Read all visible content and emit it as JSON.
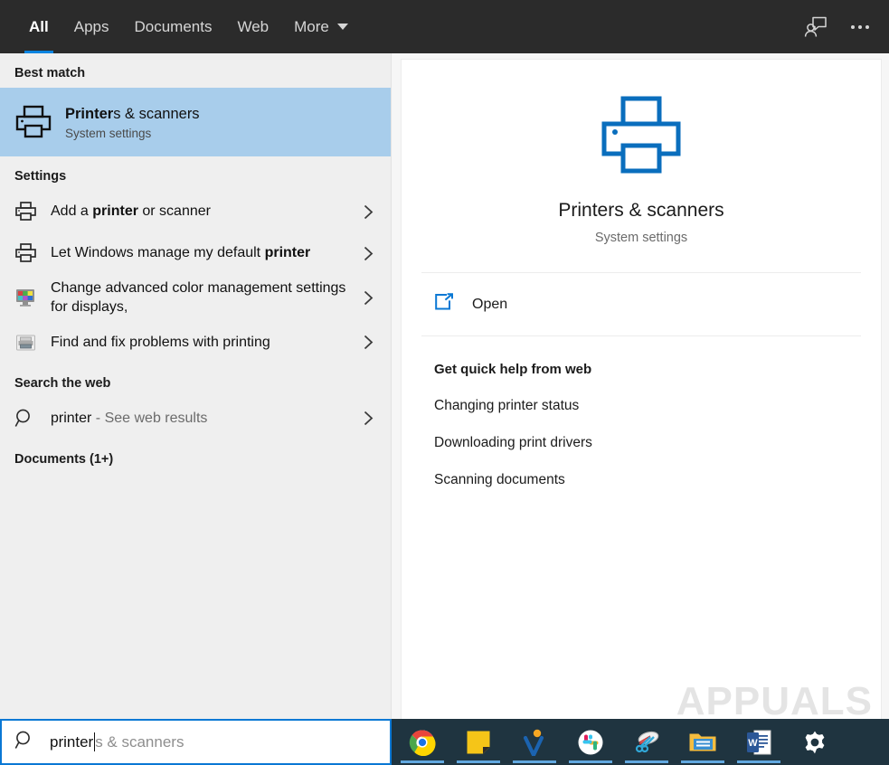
{
  "header": {
    "tabs": [
      {
        "label": "All",
        "active": true
      },
      {
        "label": "Apps",
        "active": false
      },
      {
        "label": "Documents",
        "active": false
      },
      {
        "label": "Web",
        "active": false
      },
      {
        "label": "More",
        "active": false,
        "has_caret": true
      }
    ],
    "feedback_icon": "feedback-person-icon",
    "overflow_icon": "more-options-icon",
    "accent_color": "#0a84e0",
    "background_color": "#2b2b2b"
  },
  "left_pane": {
    "best_match": {
      "section_label": "Best match",
      "title_bold": "Printer",
      "title_rest": "s & scanners",
      "subtitle": "System settings",
      "icon": "printer-icon",
      "highlight_color": "#a8cdeb"
    },
    "settings": {
      "section_label": "Settings",
      "items": [
        {
          "pre": "Add a ",
          "bold": "printer",
          "post": " or scanner",
          "icon": "printer-small-icon"
        },
        {
          "pre": "Let Windows manage my default ",
          "bold": "printer",
          "post": "",
          "icon": "printer-small-icon"
        },
        {
          "pre": "Change advanced color management settings for displays,",
          "bold": "",
          "post": "",
          "icon": "color-monitor-icon"
        },
        {
          "pre": "Find and fix problems with printing",
          "bold": "",
          "post": "",
          "icon": "printer-legacy-icon"
        }
      ]
    },
    "web": {
      "section_label": "Search the web",
      "query": "printer",
      "suffix": " - See web results",
      "icon": "search-icon"
    },
    "documents": {
      "section_label": "Documents (1+)"
    }
  },
  "right_pane": {
    "hero": {
      "icon": "printer-large-icon",
      "icon_color": "#0a6ebd",
      "title": "Printers & scanners",
      "subtitle": "System settings"
    },
    "open_action": {
      "label": "Open",
      "icon": "open-external-icon"
    },
    "help": {
      "title": "Get quick help from web",
      "links": [
        "Changing printer status",
        "Downloading print drivers",
        "Scanning documents"
      ]
    }
  },
  "watermark": {
    "text": "APPUALS",
    "url": "wsxdn.com"
  },
  "search_bar": {
    "typed": "printer",
    "ghost": "s & scanners",
    "icon": "search-icon",
    "border_color": "#0a78d4"
  },
  "taskbar": {
    "background_color": "#1f3440",
    "items": [
      {
        "name": "chrome-icon",
        "label": "Google Chrome"
      },
      {
        "name": "sticky-notes-icon",
        "label": "Sticky Notes"
      },
      {
        "name": "x-app-icon",
        "label": "X App"
      },
      {
        "name": "slack-icon",
        "label": "Slack"
      },
      {
        "name": "snipping-tool-icon",
        "label": "Snipping Tool"
      },
      {
        "name": "file-explorer-icon",
        "label": "File Explorer"
      },
      {
        "name": "word-icon",
        "label": "Microsoft Word"
      },
      {
        "name": "settings-gear-icon",
        "label": "Settings"
      }
    ]
  }
}
